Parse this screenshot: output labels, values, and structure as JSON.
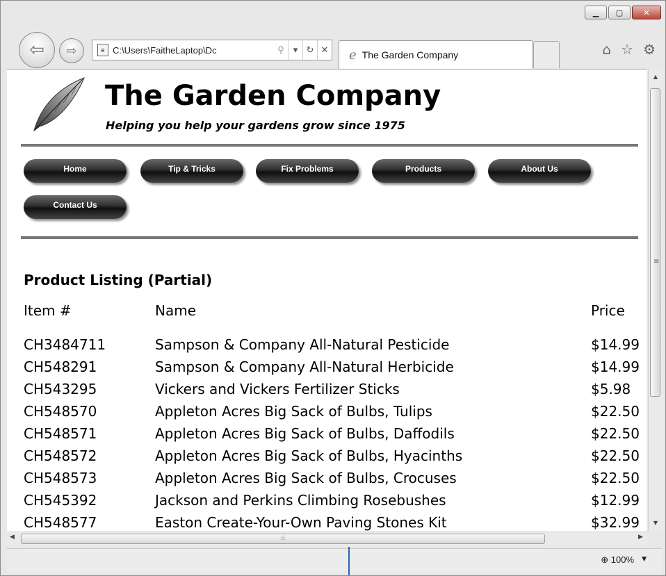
{
  "browser": {
    "address_url": "C:\\Users\\FaitheLaptop\\Dc",
    "tab_title": "The Garden Company",
    "zoom_level": "100%"
  },
  "site": {
    "title": "The Garden Company",
    "subtitle": "Helping you help your gardens grow since 1975",
    "nav": [
      "Home",
      "Tip & Tricks",
      "Fix Problems",
      "Products",
      "About Us",
      "Contact Us"
    ]
  },
  "listing": {
    "title": "Product Listing (Partial)",
    "headers": {
      "item": "Item #",
      "name": "Name",
      "price": "Price"
    },
    "rows": [
      {
        "item": "CH3484711",
        "name": "Sampson & Company All-Natural Pesticide",
        "price": "$14.99"
      },
      {
        "item": "CH548291",
        "name": "Sampson & Company All-Natural Herbicide",
        "price": "$14.99"
      },
      {
        "item": "CH543295",
        "name": "Vickers and Vickers Fertilizer Sticks",
        "price": "$5.98"
      },
      {
        "item": "CH548570",
        "name": "Appleton Acres Big Sack of Bulbs, Tulips",
        "price": "$22.50"
      },
      {
        "item": "CH548571",
        "name": "Appleton Acres Big Sack of Bulbs, Daffodils",
        "price": "$22.50"
      },
      {
        "item": "CH548572",
        "name": "Appleton Acres Big Sack of Bulbs, Hyacinths",
        "price": "$22.50"
      },
      {
        "item": "CH548573",
        "name": "Appleton Acres Big Sack of Bulbs, Crocuses",
        "price": "$22.50"
      },
      {
        "item": "CH545392",
        "name": "Jackson and Perkins Climbing Rosebushes",
        "price": "$12.99"
      },
      {
        "item": "CH548577",
        "name": "Easton Create-Your-Own Paving Stones Kit",
        "price": "$32.99"
      }
    ]
  },
  "icons": {
    "back": "back-arrow-icon",
    "forward": "forward-arrow-icon",
    "home": "home-icon",
    "favorites": "star-icon",
    "tools": "gear-icon",
    "tab": "ie-logo-icon",
    "zoom": "zoom-icon",
    "logo": "leaf-icon"
  }
}
